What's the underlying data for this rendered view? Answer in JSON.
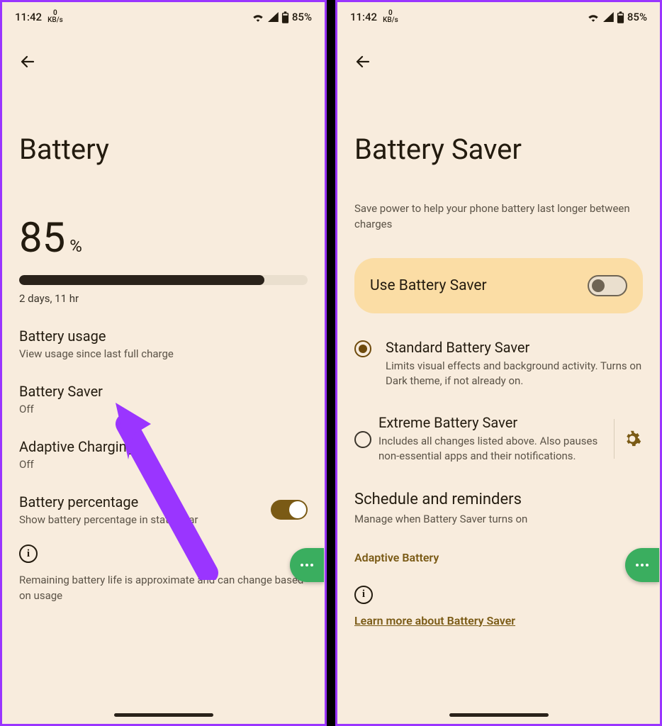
{
  "status": {
    "time": "11:42",
    "kbs_num": "0",
    "kbs_unit": "KB/s",
    "battery_pct": "85%"
  },
  "left": {
    "title": "Battery",
    "pct_value": "85",
    "pct_symbol": "%",
    "bar_fill_pct": 85,
    "estimate": "2 days, 11 hr",
    "items": [
      {
        "title": "Battery usage",
        "sub": "View usage since last full charge"
      },
      {
        "title": "Battery Saver",
        "sub": "Off"
      },
      {
        "title": "Adaptive Charging",
        "sub": "Off"
      },
      {
        "title": "Battery percentage",
        "sub": "Show battery percentage in status bar"
      }
    ],
    "info": "Remaining battery life is approximate and can change based on usage"
  },
  "right": {
    "title": "Battery Saver",
    "subtitle": "Save power to help your phone battery last longer between charges",
    "card_title": "Use Battery Saver",
    "modes": [
      {
        "title": "Standard Battery Saver",
        "sub": "Limits visual effects and background activity. Turns on Dark theme, if not already on."
      },
      {
        "title": "Extreme Battery Saver",
        "sub": "Includes all changes listed above. Also pauses non-essential apps and their notifications."
      }
    ],
    "schedule_title": "Schedule and reminders",
    "schedule_sub": "Manage when Battery Saver turns on",
    "adaptive": "Adaptive Battery",
    "learn": "Learn more about Battery Saver"
  }
}
